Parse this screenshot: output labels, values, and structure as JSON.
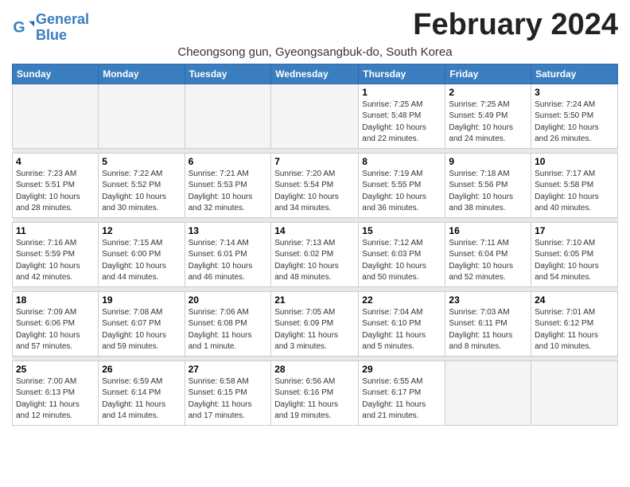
{
  "logo": {
    "text_general": "General",
    "text_blue": "Blue"
  },
  "header": {
    "month_year": "February 2024",
    "location": "Cheongsong gun, Gyeongsangbuk-do, South Korea"
  },
  "weekdays": [
    "Sunday",
    "Monday",
    "Tuesday",
    "Wednesday",
    "Thursday",
    "Friday",
    "Saturday"
  ],
  "weeks": [
    [
      {
        "day": "",
        "info": ""
      },
      {
        "day": "",
        "info": ""
      },
      {
        "day": "",
        "info": ""
      },
      {
        "day": "",
        "info": ""
      },
      {
        "day": "1",
        "info": "Sunrise: 7:25 AM\nSunset: 5:48 PM\nDaylight: 10 hours\nand 22 minutes."
      },
      {
        "day": "2",
        "info": "Sunrise: 7:25 AM\nSunset: 5:49 PM\nDaylight: 10 hours\nand 24 minutes."
      },
      {
        "day": "3",
        "info": "Sunrise: 7:24 AM\nSunset: 5:50 PM\nDaylight: 10 hours\nand 26 minutes."
      }
    ],
    [
      {
        "day": "4",
        "info": "Sunrise: 7:23 AM\nSunset: 5:51 PM\nDaylight: 10 hours\nand 28 minutes."
      },
      {
        "day": "5",
        "info": "Sunrise: 7:22 AM\nSunset: 5:52 PM\nDaylight: 10 hours\nand 30 minutes."
      },
      {
        "day": "6",
        "info": "Sunrise: 7:21 AM\nSunset: 5:53 PM\nDaylight: 10 hours\nand 32 minutes."
      },
      {
        "day": "7",
        "info": "Sunrise: 7:20 AM\nSunset: 5:54 PM\nDaylight: 10 hours\nand 34 minutes."
      },
      {
        "day": "8",
        "info": "Sunrise: 7:19 AM\nSunset: 5:55 PM\nDaylight: 10 hours\nand 36 minutes."
      },
      {
        "day": "9",
        "info": "Sunrise: 7:18 AM\nSunset: 5:56 PM\nDaylight: 10 hours\nand 38 minutes."
      },
      {
        "day": "10",
        "info": "Sunrise: 7:17 AM\nSunset: 5:58 PM\nDaylight: 10 hours\nand 40 minutes."
      }
    ],
    [
      {
        "day": "11",
        "info": "Sunrise: 7:16 AM\nSunset: 5:59 PM\nDaylight: 10 hours\nand 42 minutes."
      },
      {
        "day": "12",
        "info": "Sunrise: 7:15 AM\nSunset: 6:00 PM\nDaylight: 10 hours\nand 44 minutes."
      },
      {
        "day": "13",
        "info": "Sunrise: 7:14 AM\nSunset: 6:01 PM\nDaylight: 10 hours\nand 46 minutes."
      },
      {
        "day": "14",
        "info": "Sunrise: 7:13 AM\nSunset: 6:02 PM\nDaylight: 10 hours\nand 48 minutes."
      },
      {
        "day": "15",
        "info": "Sunrise: 7:12 AM\nSunset: 6:03 PM\nDaylight: 10 hours\nand 50 minutes."
      },
      {
        "day": "16",
        "info": "Sunrise: 7:11 AM\nSunset: 6:04 PM\nDaylight: 10 hours\nand 52 minutes."
      },
      {
        "day": "17",
        "info": "Sunrise: 7:10 AM\nSunset: 6:05 PM\nDaylight: 10 hours\nand 54 minutes."
      }
    ],
    [
      {
        "day": "18",
        "info": "Sunrise: 7:09 AM\nSunset: 6:06 PM\nDaylight: 10 hours\nand 57 minutes."
      },
      {
        "day": "19",
        "info": "Sunrise: 7:08 AM\nSunset: 6:07 PM\nDaylight: 10 hours\nand 59 minutes."
      },
      {
        "day": "20",
        "info": "Sunrise: 7:06 AM\nSunset: 6:08 PM\nDaylight: 11 hours\nand 1 minute."
      },
      {
        "day": "21",
        "info": "Sunrise: 7:05 AM\nSunset: 6:09 PM\nDaylight: 11 hours\nand 3 minutes."
      },
      {
        "day": "22",
        "info": "Sunrise: 7:04 AM\nSunset: 6:10 PM\nDaylight: 11 hours\nand 5 minutes."
      },
      {
        "day": "23",
        "info": "Sunrise: 7:03 AM\nSunset: 6:11 PM\nDaylight: 11 hours\nand 8 minutes."
      },
      {
        "day": "24",
        "info": "Sunrise: 7:01 AM\nSunset: 6:12 PM\nDaylight: 11 hours\nand 10 minutes."
      }
    ],
    [
      {
        "day": "25",
        "info": "Sunrise: 7:00 AM\nSunset: 6:13 PM\nDaylight: 11 hours\nand 12 minutes."
      },
      {
        "day": "26",
        "info": "Sunrise: 6:59 AM\nSunset: 6:14 PM\nDaylight: 11 hours\nand 14 minutes."
      },
      {
        "day": "27",
        "info": "Sunrise: 6:58 AM\nSunset: 6:15 PM\nDaylight: 11 hours\nand 17 minutes."
      },
      {
        "day": "28",
        "info": "Sunrise: 6:56 AM\nSunset: 6:16 PM\nDaylight: 11 hours\nand 19 minutes."
      },
      {
        "day": "29",
        "info": "Sunrise: 6:55 AM\nSunset: 6:17 PM\nDaylight: 11 hours\nand 21 minutes."
      },
      {
        "day": "",
        "info": ""
      },
      {
        "day": "",
        "info": ""
      }
    ]
  ]
}
